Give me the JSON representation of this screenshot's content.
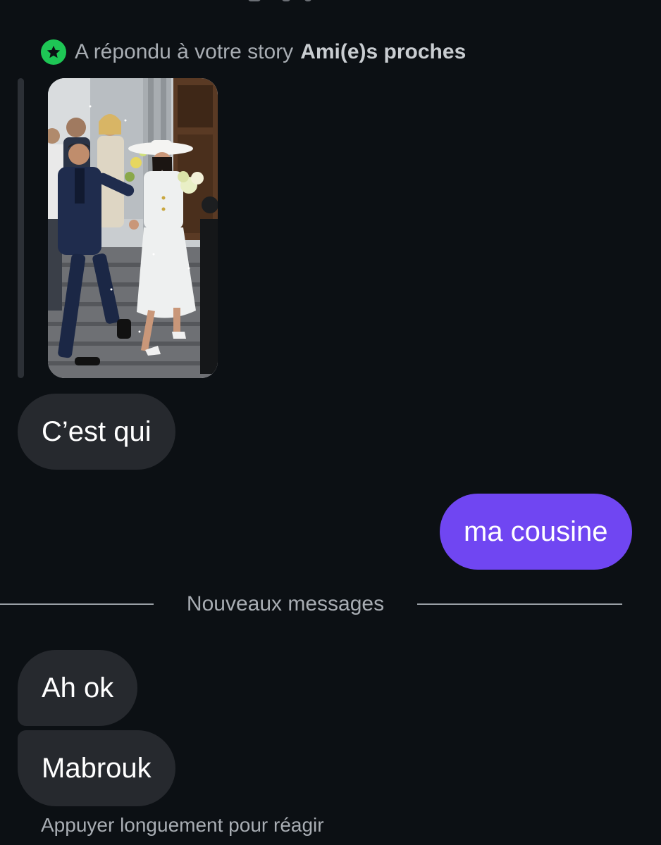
{
  "reply_header": {
    "text": "A répondu à votre story",
    "audience": "Ami(e)s proches",
    "icon": "star-icon",
    "badge_color": "#1ec655"
  },
  "story": {
    "image_alt": "story-photo"
  },
  "messages": [
    {
      "id": "m1",
      "sender": "them",
      "text": "C’est qui"
    },
    {
      "id": "m2",
      "sender": "me",
      "text": "ma cousine"
    }
  ],
  "divider": {
    "label": "Nouveaux messages"
  },
  "new_messages": [
    {
      "id": "m3",
      "sender": "them",
      "text": "Ah ok"
    },
    {
      "id": "m4",
      "sender": "them",
      "text": "Mabrouk"
    }
  ],
  "hint": "Appuyer longuement pour réagir",
  "colors": {
    "background": "#0c1014",
    "incoming_bubble": "#26292e",
    "outgoing_bubble": "#7046f2",
    "secondary_text": "#a8adb3"
  }
}
